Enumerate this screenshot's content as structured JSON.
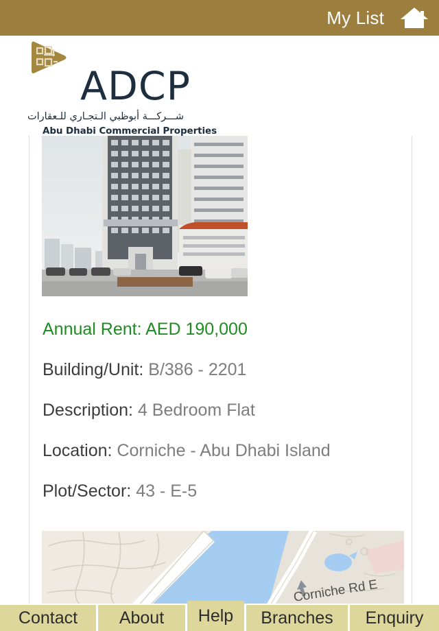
{
  "header": {
    "my_list_label": "My List",
    "home_icon": "home-icon",
    "background_color": "#9c7f3e"
  },
  "logo": {
    "wordmark": "ADCP",
    "arabic_tagline": "شـــركـــة أبوظبي الـتجـاري للـعقارات",
    "english_tagline": "Abu Dhabi Commercial Properties",
    "emblem_color": "#a3873f",
    "wordmark_color": "#1d2e3e"
  },
  "property": {
    "photo_alt": "property-building-photo",
    "rent_label": "Annual Rent:",
    "rent_value": "AED 190,000",
    "rent_color": "#1f8b22",
    "fields": [
      {
        "label": "Building/Unit:",
        "value": "B/386 - 2201"
      },
      {
        "label": "Description:",
        "value": "4 Bedroom Flat"
      },
      {
        "label": "Location:",
        "value": "Corniche - Abu Dhabi Island"
      },
      {
        "label": "Plot/Sector:",
        "value": "43 - E-5"
      }
    ]
  },
  "map": {
    "road_label": "Corniche Rd E",
    "water_color": "#a5cdf2",
    "land_color": "#efebe2",
    "road_color": "#ffffff"
  },
  "tabbar": {
    "background_color": "#ddd79b",
    "tabs": [
      {
        "label": "Contact",
        "active": false
      },
      {
        "label": "About",
        "active": false
      },
      {
        "label": "Help",
        "active": true
      },
      {
        "label": "Branches",
        "active": false
      },
      {
        "label": "Enquiry",
        "active": false
      }
    ]
  }
}
